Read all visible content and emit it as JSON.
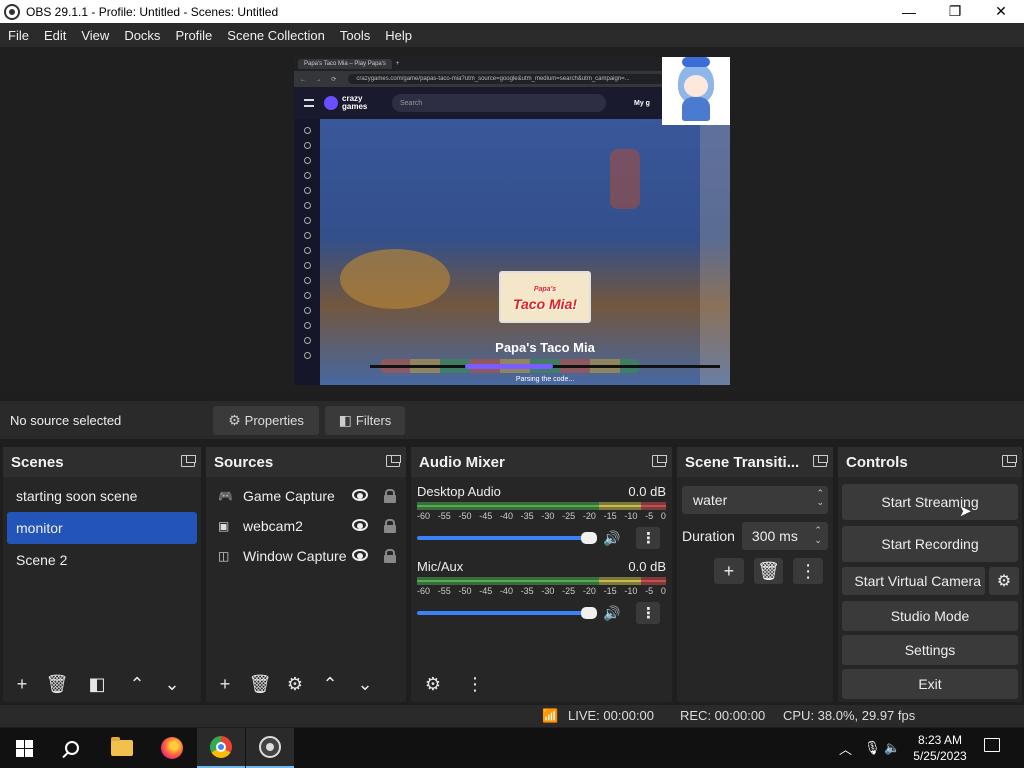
{
  "window": {
    "title": "OBS 29.1.1 - Profile: Untitled - Scenes: Untitled",
    "minimize": "—",
    "maximize": "❐",
    "close": "✕"
  },
  "menu": [
    "File",
    "Edit",
    "View",
    "Docks",
    "Profile",
    "Scene Collection",
    "Tools",
    "Help"
  ],
  "preview": {
    "browser_tab": "Papa's Taco Mia – Play Papa's",
    "nav": "← → ⟳",
    "url": "crazygames.com/game/papas-taco-mia?utm_source=google&utm_medium=search&utm_campaign=...",
    "site_logo": "crazy games",
    "search_placeholder": "Search",
    "my_label": "My g",
    "logo_small": "Papa's",
    "logo_main": "Taco Mia!",
    "game_title": "Papa's Taco Mia",
    "load_status": "Parsing the code...",
    "load_progress_fraction": 0.25
  },
  "source_toolbar": {
    "no_source": "No source selected",
    "properties": "Properties",
    "filters": "Filters"
  },
  "scenes": {
    "title": "Scenes",
    "items": [
      "starting soon scene",
      "monitor",
      "Scene 2"
    ],
    "selected": "monitor"
  },
  "sources": {
    "title": "Sources",
    "items": [
      {
        "name": "Game Capture",
        "icon": "gamepad-icon"
      },
      {
        "name": "webcam2",
        "icon": "image-icon"
      },
      {
        "name": "Window Capture",
        "icon": "window-icon"
      }
    ]
  },
  "mixer": {
    "title": "Audio Mixer",
    "channels": [
      {
        "name": "Desktop Audio",
        "level": "0.0 dB"
      },
      {
        "name": "Mic/Aux",
        "level": "0.0 dB"
      }
    ],
    "ticks": [
      "-60",
      "-55",
      "-50",
      "-45",
      "-40",
      "-35",
      "-30",
      "-25",
      "-20",
      "-15",
      "-10",
      "-5",
      "0"
    ]
  },
  "transitions": {
    "title": "Scene Transiti...",
    "selected": "water",
    "duration_label": "Duration",
    "duration_value": "300 ms"
  },
  "controls": {
    "title": "Controls",
    "start_streaming": "Start Streaming",
    "start_recording": "Start Recording",
    "start_virtual_camera": "Start Virtual Camera",
    "studio_mode": "Studio Mode",
    "settings": "Settings",
    "exit": "Exit"
  },
  "status": {
    "live": "LIVE: 00:00:00",
    "rec": "REC: 00:00:00",
    "cpu": "CPU: 38.0%, 29.97 fps"
  },
  "taskbar": {
    "time": "8:23 AM",
    "date": "5/25/2023"
  }
}
